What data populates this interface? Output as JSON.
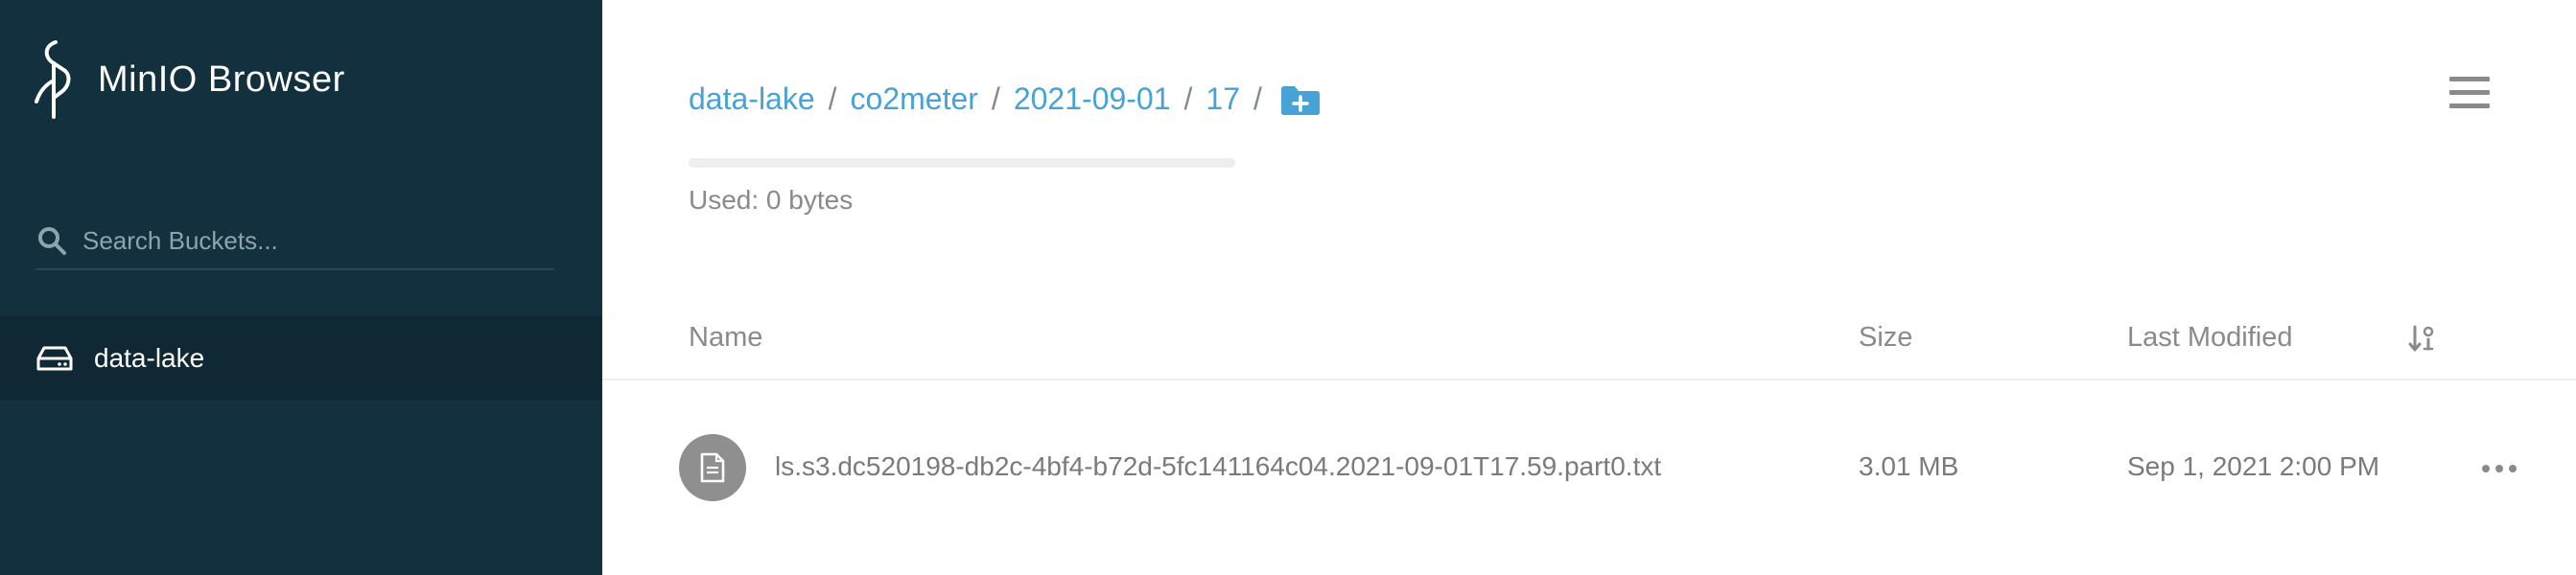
{
  "app": {
    "name": "MinIO Browser"
  },
  "sidebar": {
    "search": {
      "placeholder": "Search Buckets..."
    },
    "buckets": [
      {
        "label": "data-lake",
        "icon": "drive-icon"
      }
    ]
  },
  "breadcrumb": {
    "crumbs": [
      "data-lake",
      "co2meter",
      "2021-09-01",
      "17"
    ],
    "separator": "/"
  },
  "storage": {
    "used_text": "Used: 0 bytes",
    "used_fraction": 0
  },
  "list": {
    "columns": {
      "name": "Name",
      "size": "Size",
      "last_modified": "Last Modified"
    },
    "rows": [
      {
        "name": "ls.s3.dc520198-db2c-4bf4-b72d-5fc141164c04.2021-09-01T17.59.part0.txt",
        "size": "3.01 MB",
        "last_modified": "Sep 1, 2021 2:00 PM",
        "icon": "document-icon"
      }
    ]
  },
  "colors": {
    "sidebar_bg": "#12303d",
    "active_bucket_bg": "#0f2833",
    "accent": "#46a2d7",
    "muted_text": "#8a8a8a"
  }
}
